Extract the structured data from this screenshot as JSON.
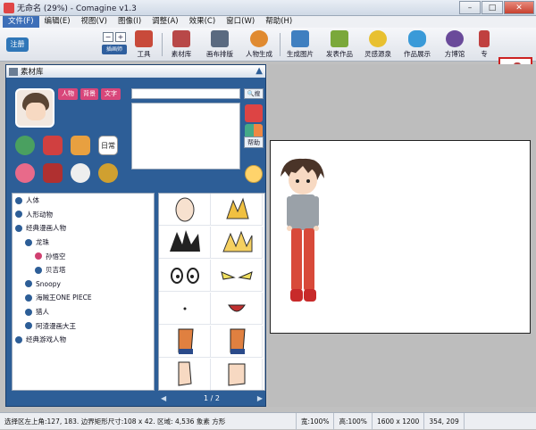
{
  "window": {
    "title": "无命名 (29%) - Comagine v1.3",
    "btn_min": "–",
    "btn_max": "□",
    "btn_close": "✕"
  },
  "menu": [
    "文件(F)",
    "编辑(E)",
    "视图(V)",
    "图像(I)",
    "调整(A)",
    "效果(C)",
    "窗口(W)",
    "帮助(H)"
  ],
  "toolbar": {
    "register": "注册",
    "mode_label": "插画师",
    "mode_minus": "−",
    "mode_plus": "+",
    "buttons": [
      {
        "label": "工具",
        "color": "#c84a3a"
      },
      {
        "label": "素材库",
        "color": "#b84848"
      },
      {
        "label": "画布排版",
        "color": "#5a6a80"
      },
      {
        "label": "人物生成",
        "color": "#e08a30"
      },
      {
        "label": "生成图片",
        "color": "#3f7fc0"
      },
      {
        "label": "发表作品",
        "color": "#7aa83a"
      },
      {
        "label": "灵感源泉",
        "color": "#e8c030"
      },
      {
        "label": "作品展示",
        "color": "#3a9ad8"
      },
      {
        "label": "方博馆",
        "color": "#6a4a9a"
      },
      {
        "label": "专",
        "color": "#c04040"
      }
    ]
  },
  "library": {
    "title": "素材库",
    "tags": [
      "人物",
      "背景",
      "文字"
    ],
    "search_btn": "搜",
    "help": "帮助",
    "daily": "日常",
    "tree": [
      {
        "label": "人体",
        "level": 0
      },
      {
        "label": "人形动物",
        "level": 0
      },
      {
        "label": "经典漫画人物",
        "level": 0
      },
      {
        "label": "龙珠",
        "level": 1
      },
      {
        "label": "孙悟空",
        "level": 2,
        "selected": true
      },
      {
        "label": "贝吉塔",
        "level": 2
      },
      {
        "label": "Snoopy",
        "level": 1
      },
      {
        "label": "海贼王ONE PIECE",
        "level": 1
      },
      {
        "label": "猎人",
        "level": 1
      },
      {
        "label": "阿渣漫画大王",
        "level": 1
      },
      {
        "label": "经典游戏人物",
        "level": 0
      }
    ],
    "page": "1 / 2",
    "prev": "◀",
    "next": "▶"
  },
  "status": {
    "selection": "选择区左上角:127, 183. 边界矩形尺寸:108 x 42. 区域: 4,536 象素 方形",
    "width": "宽:100%",
    "height": "高:100%",
    "canvas": "1600 x 1200",
    "coords": "354, 209"
  },
  "colors": {
    "panel": "#2d5e97",
    "accent": "#3d6fb8",
    "close": "#c7412f"
  }
}
